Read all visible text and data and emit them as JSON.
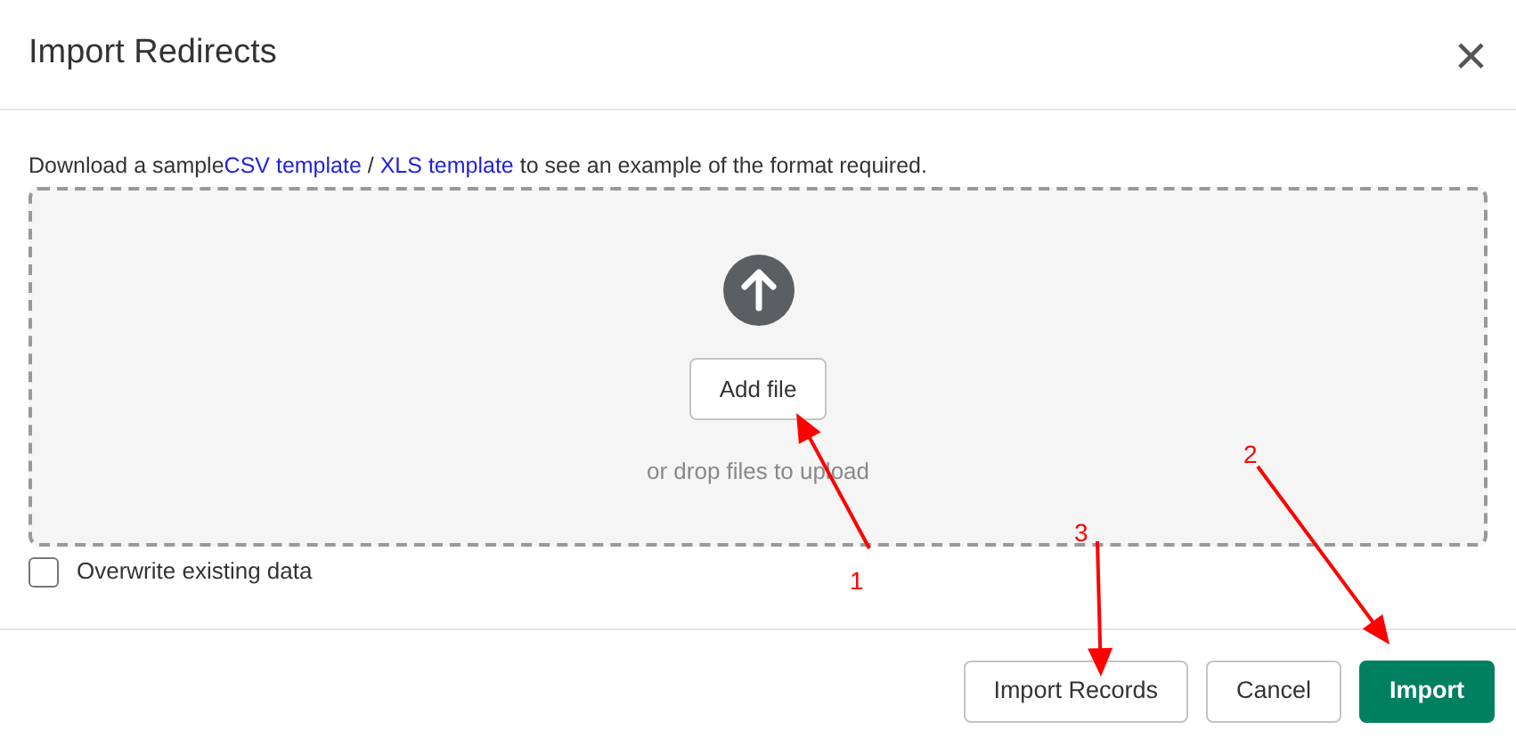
{
  "dialog": {
    "title": "Import Redirects",
    "close": "×"
  },
  "intro": {
    "before": "Download a sample",
    "links": [
      "CSV template",
      "XLS template"
    ],
    "separator": " / ",
    "after": " to see an example of the format required."
  },
  "dropzone": {
    "button": "Add file",
    "hint": "or drop files to upload"
  },
  "overwrite": {
    "label": "Overwrite existing data",
    "checked": false
  },
  "buttons": [
    {
      "label": "Import Records",
      "kind": "secondary"
    },
    {
      "label": "Cancel",
      "kind": "secondary"
    },
    {
      "label": "Import",
      "kind": "primary"
    }
  ],
  "annotations": [
    {
      "label": "1"
    },
    {
      "label": "2"
    },
    {
      "label": "3"
    }
  ]
}
